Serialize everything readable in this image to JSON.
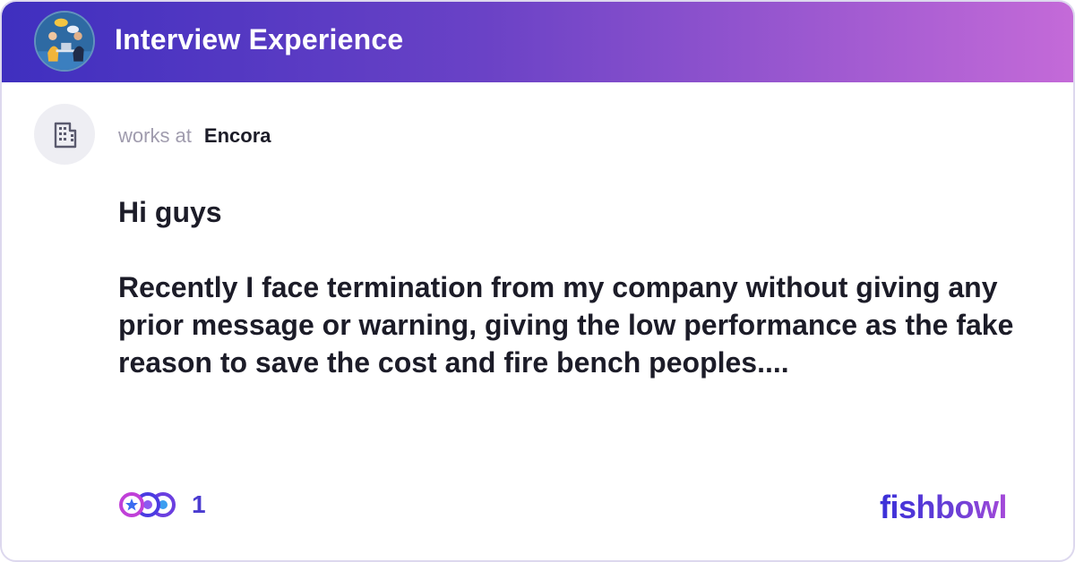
{
  "header": {
    "bowl_title": "Interview Experience",
    "gradient_start": "#3f2fbf",
    "gradient_end": "#c46ad8"
  },
  "author": {
    "works_at_label": "works at",
    "company": "Encora",
    "avatar_icon": "building-icon"
  },
  "post": {
    "greeting": "Hi guys",
    "body": "Recently I face termination from my company without giving any prior message or warning, giving the low performance as the fake reason to save the cost and fire bench peoples...."
  },
  "reactions": {
    "icons": [
      "star-reaction-icon",
      "heart-reaction-icon",
      "clap-reaction-icon"
    ],
    "count": "1"
  },
  "brand": {
    "name": "fishbowl",
    "color": "#3a30d8"
  }
}
